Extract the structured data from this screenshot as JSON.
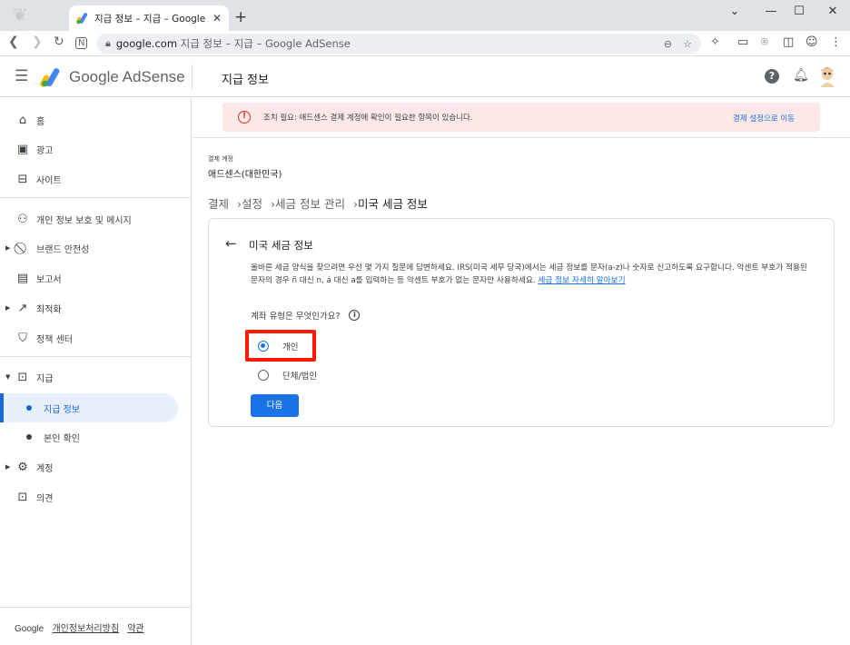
{
  "browser": {
    "tab_title": "지급 정보 – 지급 – Google AdSe",
    "new_tab": "+",
    "url_host": "google.com",
    "url_path": " 지급 정보 – 지급 – Google AdSense",
    "controls": {
      "minimize": "⌄",
      "restore": "—",
      "maximize": "☐",
      "close": "✕"
    }
  },
  "app": {
    "brand": "Google AdSense",
    "page_title": "지급 정보"
  },
  "sidebar": {
    "items": [
      {
        "label": "홈",
        "icon": "home-icon"
      },
      {
        "label": "광고",
        "icon": "ads-icon"
      },
      {
        "label": "사이트",
        "icon": "sites-icon"
      },
      {
        "label": "개인 정보 보호 및 메시지",
        "icon": "privacy-icon"
      },
      {
        "label": "브랜드 안전성",
        "icon": "block-icon"
      },
      {
        "label": "보고서",
        "icon": "reports-icon"
      },
      {
        "label": "최적화",
        "icon": "trend-icon"
      },
      {
        "label": "정책 센터",
        "icon": "policy-icon"
      },
      {
        "label": "지급",
        "icon": "payments-icon"
      },
      {
        "label": "지급 정보",
        "icon": "dot"
      },
      {
        "label": "본인 확인",
        "icon": "dot"
      },
      {
        "label": "계정",
        "icon": "gear-icon"
      },
      {
        "label": "의견",
        "icon": "feedback-icon"
      }
    ],
    "footer": {
      "brand": "Google",
      "privacy": "개인정보처리방침",
      "terms": "약관"
    }
  },
  "alert": {
    "text": "조치 필요: 애드센스 결제 계정에 확인이 필요한 항목이 있습니다.",
    "link": "결제 설정으로 이동"
  },
  "account": {
    "label": "결제 계정",
    "name": "애드센스(대한민국)"
  },
  "breadcrumb": [
    "결제",
    "설정",
    "세금 정보 관리",
    "미국 세금 정보"
  ],
  "card": {
    "title": "미국 세금 정보",
    "description": "올바른 세금 양식을 찾으려면 우선 몇 가지 질문에 답변하세요. IRS(미국 세무 당국)에서는 세금 정보를 문자(a-z)나 숫자로 신고하도록 요구합니다. 악센트 부호가 적용된 문자의 경우 ñ 대신 n, á 대신 a를 입력하는 등 악센트 부호가 없는 문자만 사용하세요. ",
    "description_link": "세금 정보 자세히 알아보기",
    "question": "계좌 유형은 무엇인가요?",
    "options": [
      {
        "label": "개인",
        "selected": true
      },
      {
        "label": "단체/법인",
        "selected": false
      }
    ],
    "next_label": "다음"
  },
  "colors": {
    "accent": "#1a73e8",
    "alert_bg": "#fce8e6",
    "highlight": "#ff1a00"
  }
}
